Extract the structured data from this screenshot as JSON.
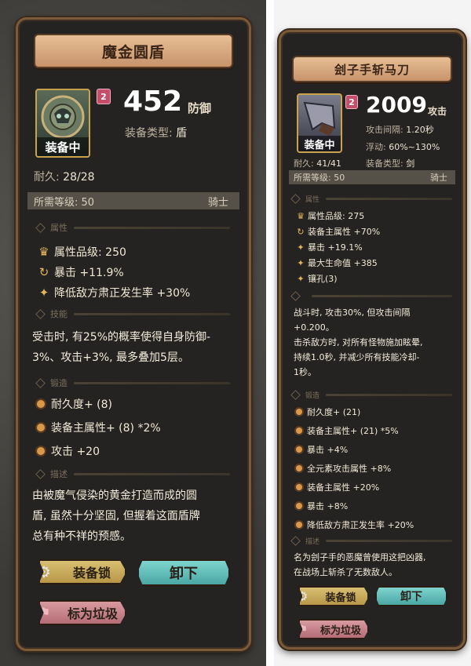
{
  "left_card": {
    "title": "魔金圆盾",
    "level_badge": "2",
    "equipped": "装备中",
    "main_value": "452",
    "main_unit": "防御",
    "type_label": "装备类型:",
    "type_value": "盾",
    "durability_label": "耐久:",
    "durability_value": "28/28",
    "req_label": "所需等级: 50",
    "req_class": "骑士",
    "sec_attr": "属性",
    "attrs": [
      {
        "icon": "quality-icon",
        "text": "属性品级: 250"
      },
      {
        "icon": "main-attr-icon",
        "text": "暴击 +11.9%"
      },
      {
        "icon": "star-icon",
        "text": "降低敌方肃正发生率 +30%"
      }
    ],
    "sec_skill": "技能",
    "skill_lines": [
      "受击时, 有25%的概率使得自身防御-",
      "3%、攻击+3%, 最多叠加5层。"
    ],
    "sec_forge": "锻造",
    "forge": [
      "耐久度+ (8)",
      "装备主属性+ (8) *2%",
      "攻击 +20"
    ],
    "sec_desc": "描述",
    "desc_lines": [
      "由被魔气侵染的黄金打造而成的圆",
      "盾, 虽然十分坚固, 但握着这面盾牌",
      "总有种不祥的预感。"
    ],
    "btn_lock": "装备锁",
    "btn_unequip": "卸下",
    "btn_trash": "标为垃圾"
  },
  "right_card": {
    "title": "刽子手斩马刀",
    "level_badge": "2",
    "equipped": "装备中",
    "main_value": "2009",
    "main_unit": "攻击",
    "interval_label": "攻击间隔:",
    "interval_value": "1.20秒",
    "float_label": "浮动:",
    "float_value": "60%~130%",
    "durability_label": "耐久:",
    "durability_value": "41/41",
    "type_label": "装备类型:",
    "type_value": "剑",
    "req_label": "所需等级: 50",
    "req_class": "骑士",
    "sec_attr": "属性",
    "attrs": [
      {
        "icon": "quality-icon",
        "text": "属性品级: 275"
      },
      {
        "icon": "main-attr-icon",
        "text": "装备主属性 +70%"
      },
      {
        "icon": "star-icon",
        "text": "暴击 +19.1%"
      },
      {
        "icon": "star-icon",
        "text": "最大生命值 +385"
      },
      {
        "icon": "star-icon",
        "text": "镶孔(3)"
      }
    ],
    "skill_lines": [
      "战斗时, 攻击30%, 但攻击间隔",
      "+0.200。",
      "击杀敌方时, 对所有怪物施加眩晕,",
      "持续1.0秒, 并减少所有技能冷却-",
      "1秒。"
    ],
    "sec_forge": "锻造",
    "forge": [
      "耐久度+ (21)",
      "装备主属性+ (21) *5%",
      "暴击 +4%",
      "全元素攻击属性 +8%",
      "装备主属性 +20%",
      "暴击 +8%",
      "降低敌方肃正发生率 +20%"
    ],
    "sec_desc": "描述",
    "desc_lines": [
      "名为刽子手的恶魔曾使用这把凶器,",
      "在战场上斩杀了无数敌人。"
    ],
    "btn_lock": "装备锁",
    "btn_unequip": "卸下",
    "btn_trash": "标为垃圾"
  }
}
